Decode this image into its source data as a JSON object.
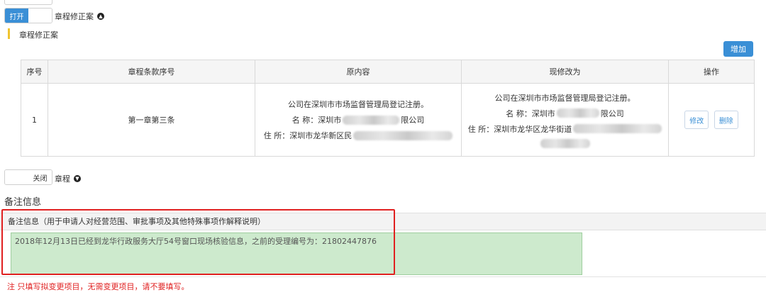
{
  "toggle_open": {
    "on_label": "打开",
    "section_label": "章程修正案"
  },
  "section": {
    "title": "章程修正案"
  },
  "add_button": "增加",
  "table": {
    "headers": [
      "序号",
      "章程条款序号",
      "原内容",
      "现修改为",
      "操作"
    ],
    "rows": [
      {
        "index": "1",
        "clause": "第一章第三条",
        "original": {
          "line1": "公司在深圳市市场监督管理局登记注册。",
          "name_prefix": "名 称：深圳市",
          "name_suffix": "限公司",
          "addr_prefix": "住 所：深圳市龙华新区民"
        },
        "revised": {
          "line1": "公司在深圳市市场监督管理局登记注册。",
          "name_prefix": "名 称：深圳市",
          "name_suffix": "限公司",
          "addr_prefix": "住 所：深圳市龙华区龙华街道"
        },
        "actions": {
          "edit": "修改",
          "delete": "删除"
        }
      }
    ]
  },
  "toggle_closed": {
    "off_label": "关闭",
    "section_label": "章程"
  },
  "remarks": {
    "title": "备注信息",
    "bar_label": "备注信息（用于申请人对经营范围、审批事项及其他特殊事项作解释说明）",
    "value": "2018年12月13日已经到龙华行政服务大厅54号窗口现场核验信息，之前的受理编号为：21802447876"
  },
  "note": "注 只填写拟变更项目，无需变更项目，请不要填写。",
  "colors": {
    "accent": "#3a8fd6",
    "highlight_field": "#cdeacd",
    "alert": "#e02020",
    "section_mark": "#f0c430"
  }
}
